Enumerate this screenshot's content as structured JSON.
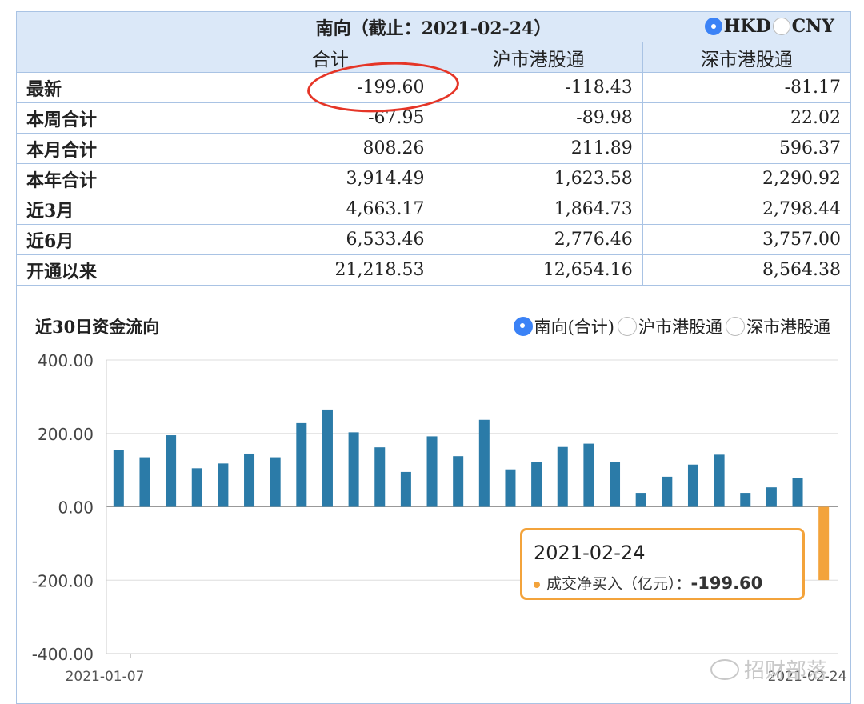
{
  "header": {
    "title": "南向（截止：2021-02-24）",
    "currency_options": [
      {
        "label": "HKD",
        "selected": true
      },
      {
        "label": "CNY",
        "selected": false
      }
    ]
  },
  "table": {
    "columns": [
      "",
      "合计",
      "沪市港股通",
      "深市港股通"
    ],
    "rows": [
      {
        "label": "最新",
        "values": [
          "-199.60",
          "-118.43",
          "-81.17"
        ]
      },
      {
        "label": "本周合计",
        "values": [
          "-67.95",
          "-89.98",
          "22.02"
        ]
      },
      {
        "label": "本月合计",
        "values": [
          "808.26",
          "211.89",
          "596.37"
        ]
      },
      {
        "label": "本年合计",
        "values": [
          "3,914.49",
          "1,623.58",
          "2,290.92"
        ]
      },
      {
        "label": "近3月",
        "values": [
          "4,663.17",
          "1,864.73",
          "2,798.44"
        ]
      },
      {
        "label": "近6月",
        "values": [
          "6,533.46",
          "2,776.46",
          "3,757.00"
        ]
      },
      {
        "label": "开通以来",
        "values": [
          "21,218.53",
          "12,654.16",
          "8,564.38"
        ]
      }
    ]
  },
  "chart_section": {
    "title": "近30日资金流向",
    "series_options": [
      {
        "label": "南向(合计)",
        "selected": true
      },
      {
        "label": "沪市港股通",
        "selected": false
      },
      {
        "label": "深市港股通",
        "selected": false
      }
    ]
  },
  "chart_data": {
    "type": "bar",
    "ylim": [
      -400,
      400
    ],
    "yticks": [
      "400.00",
      "200.00",
      "0.00",
      "-200.00",
      "-400.00"
    ],
    "ytick_values": [
      400,
      200,
      0,
      -200,
      -400
    ],
    "x_start_label": "2021-01-07",
    "x_end_label": "2021-02-24",
    "values": [
      155,
      135,
      195,
      105,
      118,
      145,
      135,
      228,
      265,
      203,
      162,
      95,
      192,
      138,
      237,
      102,
      122,
      163,
      172,
      123,
      38,
      82,
      115,
      142,
      38,
      53,
      78,
      -199.6
    ],
    "bar_color": "#2b7ba8",
    "highlight_color": "#f3a33b",
    "highlight_index": 27
  },
  "tooltip": {
    "date": "2021-02-24",
    "label": "成交净买入（亿元）：",
    "value": "-199.60"
  },
  "watermark": "招财部落"
}
